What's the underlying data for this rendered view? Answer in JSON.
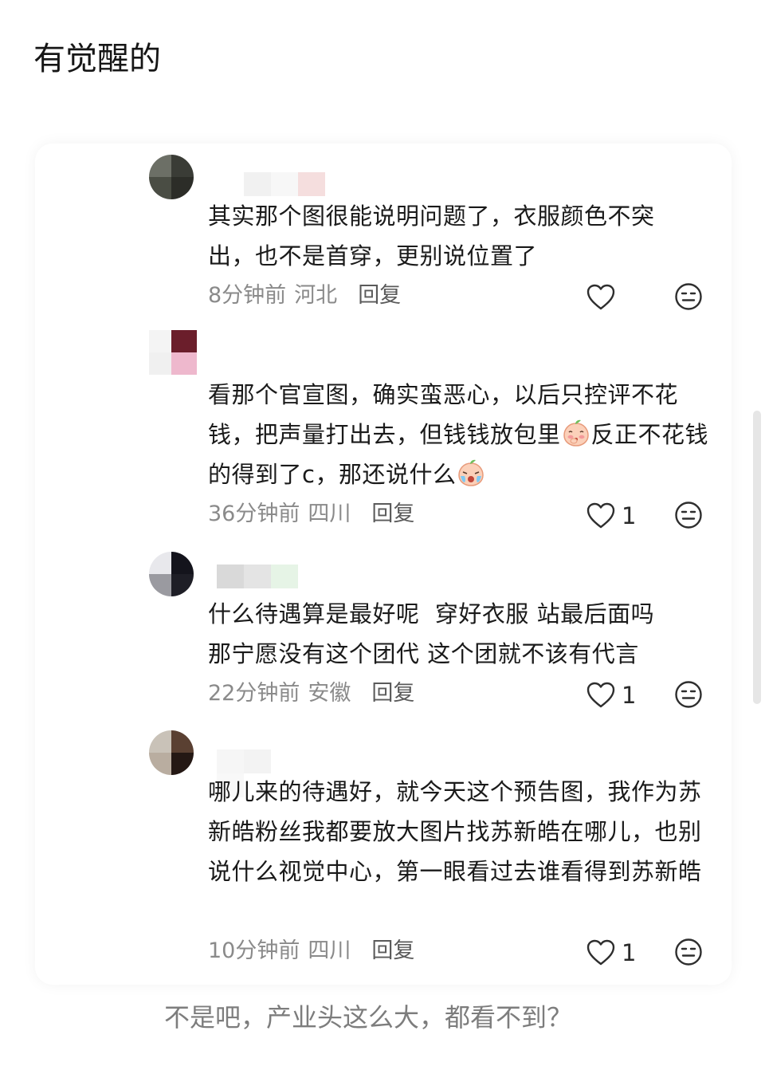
{
  "title": "有觉醒的",
  "comments": [
    {
      "text": "其实那个图很能说明问题了，衣服颜色不突出，也不是首穿，更别说位置了",
      "time": "8分钟前",
      "location": "河北",
      "reply_label": "回复",
      "likes": ""
    },
    {
      "text_part1": "看那个官宣图，确实蛮恶心，以后只控评不花钱，把声量打出去，但钱钱放包里",
      "text_part2": "反正不花钱的得到了c，那还说什么",
      "emoji_1": "shy-peach-emoji",
      "emoji_2": "crying-peach-emoji",
      "time": "36分钟前",
      "location": "四川",
      "reply_label": "回复",
      "likes": "1"
    },
    {
      "line1": "什么待遇算是最好呢  穿好衣服 站最后面吗",
      "line2": "那宁愿没有这个团代 这个团就不该有代言",
      "time": "22分钟前",
      "location": "安徽",
      "reply_label": "回复",
      "likes": "1"
    },
    {
      "text": "哪儿来的待遇好，就今天这个预告图，我作为苏新皓粉丝我都要放大图片找苏新皓在哪儿，也别说什么视觉中心，第一眼看过去谁看得到苏新皓",
      "time": "10分钟前",
      "location": "四川",
      "reply_label": "回复",
      "likes": "1"
    }
  ],
  "caption": "不是吧，产业头这么大，都看不到？",
  "icons": {
    "like": "heart-outline-icon",
    "dislike": "neutral-face-icon"
  },
  "colors": {
    "text": "#1a1a1a",
    "meta": "#8a8a8a",
    "caption": "#7d7d7d"
  }
}
